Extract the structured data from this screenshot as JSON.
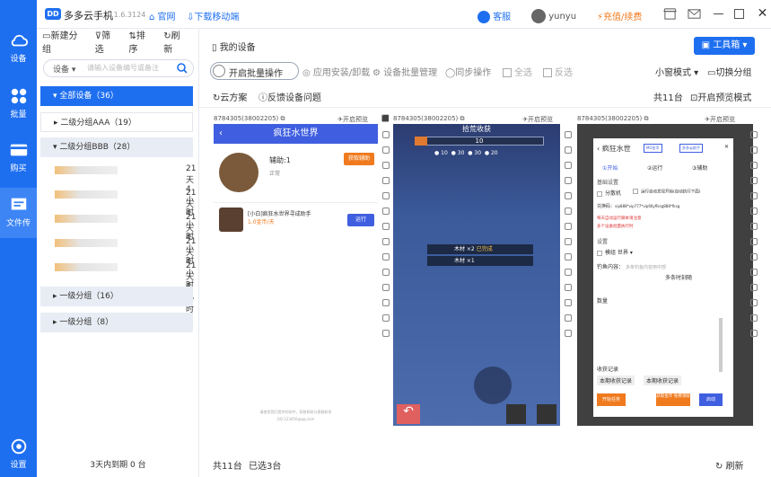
{
  "app": {
    "name": "多多云手机",
    "version": "v.1.6.3124",
    "official": "官网",
    "download": "下载移动端",
    "service": "客服",
    "user": "yunyu",
    "recharge": "充值/续费",
    "logo": "DD"
  },
  "nav": [
    {
      "label": "设备"
    },
    {
      "label": "批量"
    },
    {
      "label": "购买"
    },
    {
      "label": "文件传"
    },
    {
      "label": "设置"
    }
  ],
  "list": {
    "tools": [
      "新建分组",
      "筛选",
      "排序",
      "刷新"
    ],
    "search_type": "设备",
    "search_placeholder": "请输入设备编号或备注",
    "groups": [
      {
        "label": "全部设备（36）"
      },
      {
        "label": "二级分组AAA（19）"
      },
      {
        "label": "二级分组BBB（28）"
      },
      {
        "label": "一级分组（16）"
      },
      {
        "label": "一级分组（8）"
      }
    ],
    "devices": [
      {
        "status": "21天4小时"
      },
      {
        "status": "21天4小时"
      },
      {
        "status": "21天4小时"
      },
      {
        "status": "21天4小时"
      },
      {
        "status": "21天4小时"
      }
    ],
    "footer": "3天内到期 0 台"
  },
  "toolbar": {
    "my_devices": "我的设备",
    "batch": "开启批量操作",
    "install": "应用安装/卸载",
    "batch_mgmt": "设备批量管理",
    "sync": "同步操作",
    "select_all": "全选",
    "invert": "反选",
    "view": "小窗模式",
    "switch_group": "切换分组",
    "tools": "工具箱",
    "cloud_plan": "云方案",
    "feedback": "反馈设备问题",
    "total": "共11台",
    "preview": "开启预览模式"
  },
  "cards": [
    {
      "id": "8784305(38002205)",
      "preview": "开启预览",
      "title": "疯狂水世界",
      "assist": "辅助:1",
      "assist_sub": "正常",
      "assist_btn": "获取辅助",
      "game": "[小白]疯狂水世界寻成助手",
      "rate": "1.0金币/天",
      "run": "运行",
      "footer": "请使用我们提供的软件，获取帮助与客服联系",
      "footer2": "QQ:123456@qq.com"
    },
    {
      "id": "8784305(38002205)",
      "preview": "开启预览",
      "game_title": "拾荒收获",
      "game_level": "10",
      "r1": "10",
      "r2": "30",
      "r3": "30",
      "r4": "20",
      "item1": "木材 ×2",
      "item1b": "已完成",
      "item2": "木材 ×1"
    },
    {
      "id": "8784305(38002205)",
      "preview": "开启预览",
      "title": "疯狂水世",
      "tab1": "MO金币",
      "tab2": "多多云助手",
      "t1": "①开始",
      "t2": "②运行",
      "t3": "③辅助",
      "sec1": "基础设置",
      "opt1": "分散机",
      "opt2": "运行自动发现开始(自动执行下面)",
      "label1": "兑换码：",
      "code": "vip888*vip777*vip66yflksg888*fksg",
      "warn1": "每天自动运行脚本请注意",
      "warn2": "多个设备批量执行时",
      "sec2": "设置",
      "opt3": "模组",
      "world": "世界",
      "fish": "钓鱼内容：",
      "fish_ph": "多条钓鱼内容用中部",
      "fish_val": "多条时刻随",
      "num_l": "数量",
      "rec": "收获记录",
      "rec1": "本期收获记录",
      "rec2": "本期收获记录",
      "btn1": "开始任务",
      "btn2": "获取金币 免费领取",
      "btn3": "启动"
    }
  ],
  "bottom": {
    "total": "共11台",
    "selected": "已选3台",
    "refresh": "刷新"
  },
  "colors": {
    "accent": "#1e6ff0",
    "orange": "#f07a1e"
  }
}
